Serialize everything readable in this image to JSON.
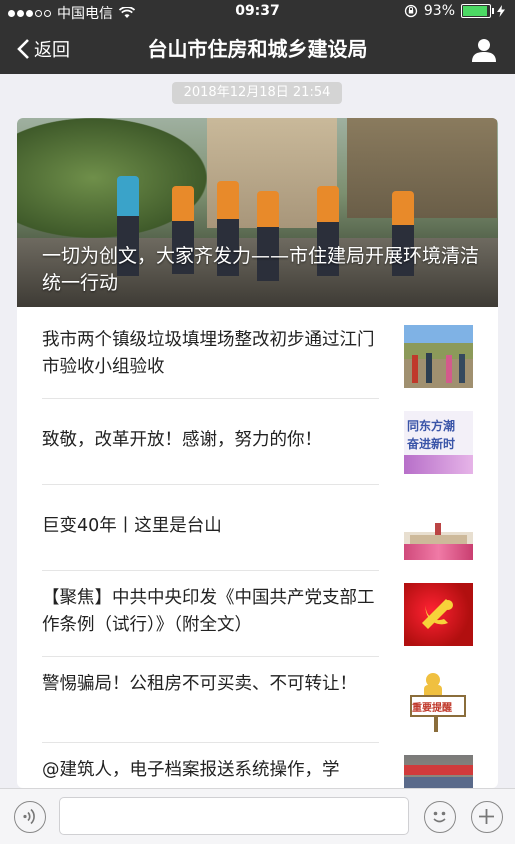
{
  "status_bar": {
    "carrier": "中国电信",
    "time": "09:37",
    "battery_percent_label": "93%",
    "battery_level": 0.93,
    "signal_icon": "signal-dots-icon",
    "wifi_icon": "wifi-icon",
    "lock_icon": "rotation-lock-icon",
    "charging_icon": "charging-bolt-icon"
  },
  "nav": {
    "back_label": "返回",
    "title": "台山市住房和城乡建设局",
    "back_icon": "chevron-left-icon",
    "profile_icon": "person-icon"
  },
  "message": {
    "timestamp": "2018年12月18日 21:54",
    "hero": {
      "title": "一切为创文，大家齐发力——市住建局开展环境清洁统一行动"
    },
    "articles": [
      {
        "title": "我市两个镇级垃圾填埋场整改初步通过江门市验收小组验收"
      },
      {
        "title": "致敬，改革开放！感谢，努力的你！"
      },
      {
        "title": "巨变40年丨这里是台山"
      },
      {
        "title": "【聚焦】中共中央印发《中国共产党支部工作条例（试行）》（附全文）"
      },
      {
        "title": "警惕骗局！公租房不可买卖、不可转让！"
      },
      {
        "title": "@建筑人，电子档案报送系统操作，学"
      }
    ],
    "thumb_texts": {
      "t2_line1": "同东方潮",
      "t2_line2": "奋进新时",
      "t5_sign": "重要提醒"
    }
  },
  "input_bar": {
    "voice_icon": "voice-icon",
    "emoji_icon": "emoji-icon",
    "plus_icon": "plus-icon"
  },
  "colors": {
    "bar_bg": "#323232",
    "page_bg": "#efeff4",
    "battery_green": "#4cd964"
  }
}
